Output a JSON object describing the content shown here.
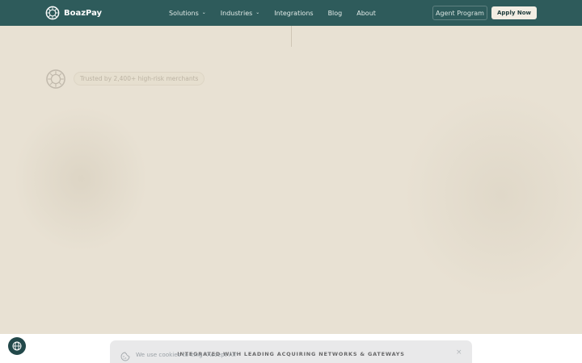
{
  "brand": {
    "name": "BoazPay",
    "logo_icon": "sun-ring-icon"
  },
  "nav": {
    "items": [
      {
        "label": "Solutions",
        "has_dropdown": true
      },
      {
        "label": "Industries",
        "has_dropdown": true
      },
      {
        "label": "Integrations",
        "has_dropdown": false
      },
      {
        "label": "Blog",
        "has_dropdown": false
      },
      {
        "label": "About",
        "has_dropdown": false
      }
    ],
    "chevron": "⌄",
    "agent_label": "Agent Program",
    "apply_label": "Apply Now"
  },
  "hero": {
    "trust_icon": "sun-ring-icon",
    "trust_text": "Trusted by 2,400+ high-risk merchants"
  },
  "partners": {
    "title": "INTEGRATED WITH LEADING ACQUIRING NETWORKS & GATEWAYS"
  },
  "cookie": {
    "icon": "cookie-icon",
    "text": "We use cookies to                                                                        king \"Accept All\"",
    "close": "×"
  },
  "language": {
    "icon": "globe-icon"
  },
  "colors": {
    "nav_bg": "#2e5b5b",
    "hero_bg": "#e8e1d3",
    "apply_bg": "#f2ede3",
    "globe_bg": "#22484a"
  }
}
